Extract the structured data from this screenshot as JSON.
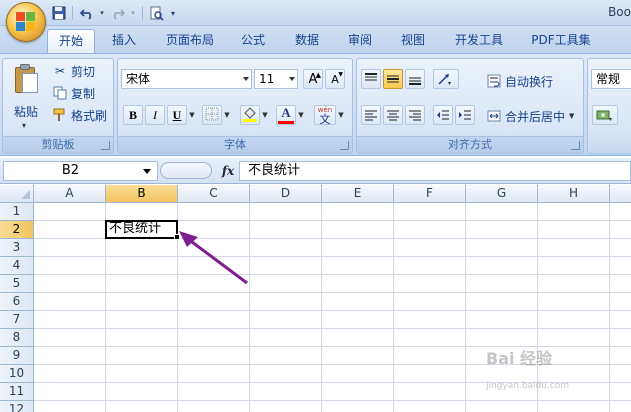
{
  "window": {
    "title": "Boo"
  },
  "qat": {
    "save": "save-icon",
    "undo": "undo-icon",
    "redo": "redo-icon",
    "preview": "print-preview-icon"
  },
  "tabs": [
    {
      "label": "开始",
      "active": true
    },
    {
      "label": "插入"
    },
    {
      "label": "页面布局"
    },
    {
      "label": "公式"
    },
    {
      "label": "数据"
    },
    {
      "label": "审阅"
    },
    {
      "label": "视图"
    },
    {
      "label": "开发工具"
    },
    {
      "label": "PDF工具集"
    }
  ],
  "clipboard": {
    "paste": "粘贴",
    "cut": "剪切",
    "copy": "复制",
    "format_painter": "格式刷",
    "group_label": "剪贴板"
  },
  "font": {
    "name": "宋体",
    "size": "11",
    "bold": "B",
    "italic": "I",
    "underline": "U",
    "font_color_letter": "A",
    "phonetic": "wén",
    "phonetic_char": "文",
    "grow": "A",
    "shrink": "A",
    "group_label": "字体"
  },
  "alignment": {
    "wrap_text": "自动换行",
    "merge_center": "合并后居中",
    "group_label": "对齐方式"
  },
  "number": {
    "format": "常规"
  },
  "formula_bar": {
    "name_box": "B2",
    "fx": "fx",
    "content": "不良统计"
  },
  "columns": [
    "A",
    "B",
    "C",
    "D",
    "E",
    "F",
    "G",
    "H"
  ],
  "rows": [
    "1",
    "2",
    "3",
    "4",
    "5",
    "6",
    "7",
    "8",
    "9",
    "10",
    "11",
    "12"
  ],
  "cells": {
    "B2": "不良统计"
  },
  "selected": {
    "column": "B",
    "row": "2"
  },
  "watermark": {
    "line1": "Bai 经验",
    "line2": "jingyan.baidu.com"
  },
  "colors": {
    "arrow": "#7d1f8c",
    "accent": "#15428b",
    "selection_header": "#f6c868"
  }
}
